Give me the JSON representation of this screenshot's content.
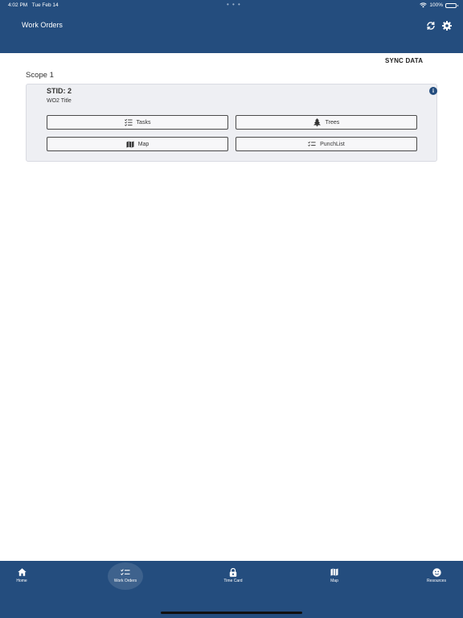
{
  "status_bar": {
    "time": "4:02 PM",
    "date": "Tue Feb 14",
    "dots": "• • •",
    "battery": "100%"
  },
  "header": {
    "title": "Work Orders"
  },
  "sync_data_label": "SYNC DATA",
  "scope": {
    "label": "Scope 1"
  },
  "card": {
    "stid": "STID: 2",
    "title": "WO2 Title",
    "buttons": {
      "tasks": "Tasks",
      "trees": "Trees",
      "map": "Map",
      "punchlist": "PunchList"
    }
  },
  "tabs": [
    {
      "label": "Home",
      "icon": "home-icon"
    },
    {
      "label": "Work Orders",
      "icon": "checklist-icon"
    },
    {
      "label": "Time Card",
      "icon": "lock-icon"
    },
    {
      "label": "Map",
      "icon": "map-icon"
    },
    {
      "label": "Resources",
      "icon": "smiley-icon"
    }
  ],
  "colors": {
    "primary": "#244d7e",
    "card_bg": "#eeeff3"
  }
}
